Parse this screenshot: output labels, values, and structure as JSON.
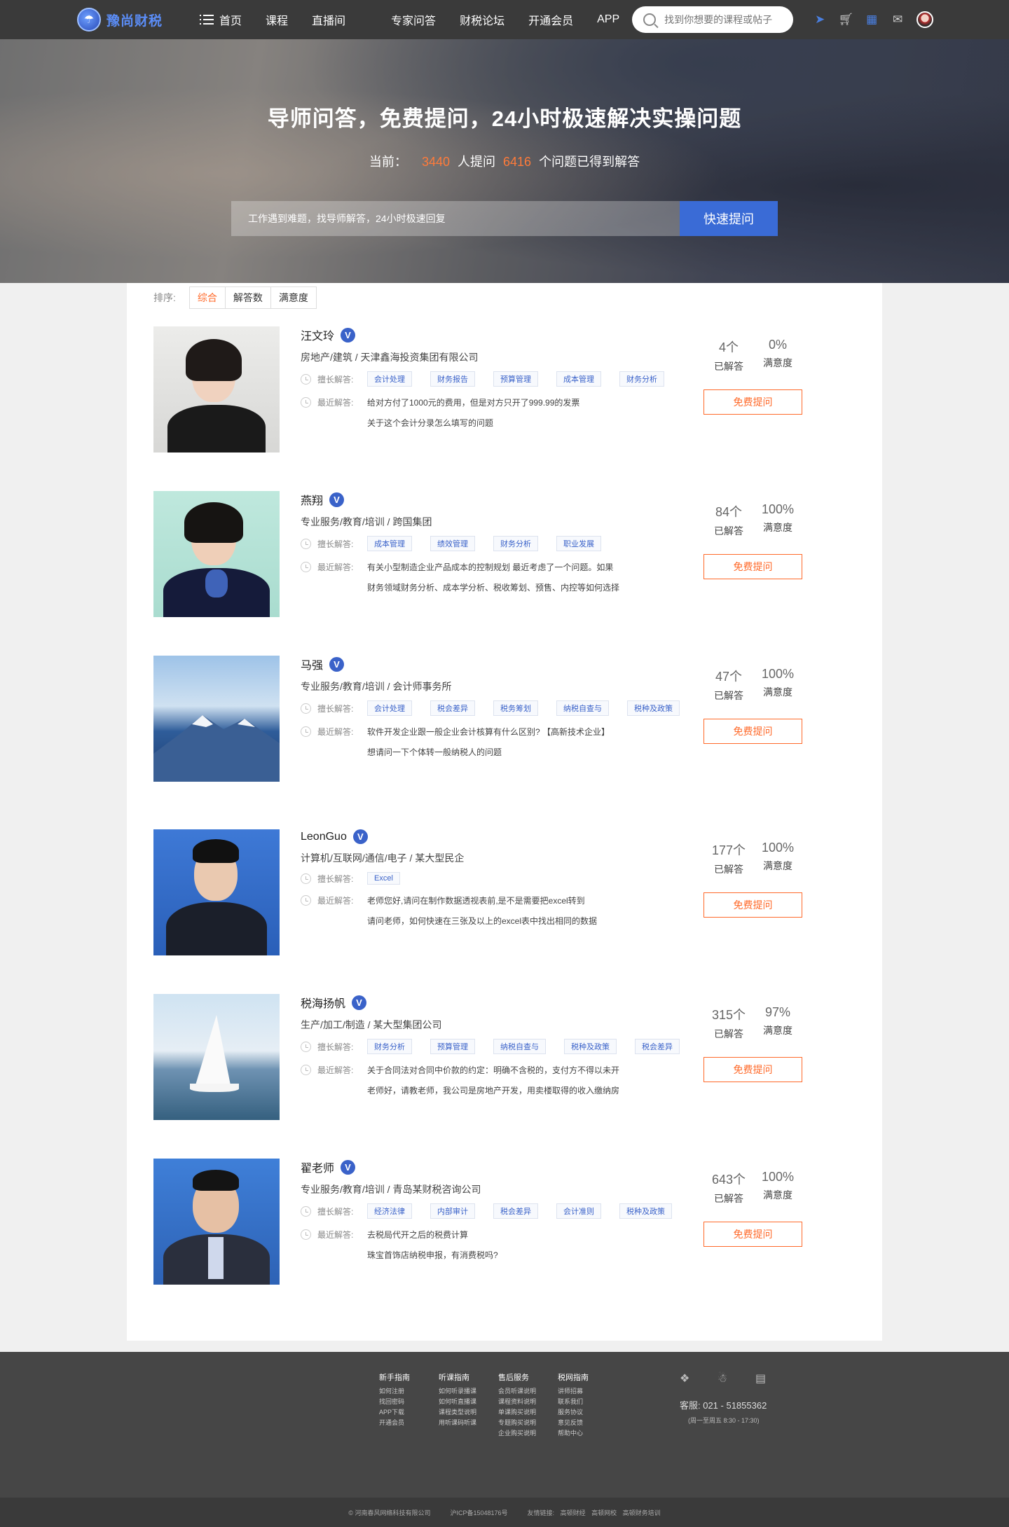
{
  "nav": {
    "logo_text": "豫尚财税",
    "links": [
      "首页",
      "课程",
      "直播间",
      "专家问答",
      "财税论坛",
      "开通会员",
      "APP"
    ],
    "search_placeholder": "找到你想要的课程或帖子",
    "icons": [
      "send-icon",
      "cart-icon",
      "gift-icon",
      "message-icon",
      "user-avatar"
    ]
  },
  "hero": {
    "title": "导师问答，免费提问，24小时极速解决实操问题",
    "stats_prefix": "当前：",
    "askers": "3440",
    "askers_label": "人提问",
    "answered": "6416",
    "answered_label": "个问题已得到解答",
    "input_placeholder": "工作遇到难题，找导师解答，24小时极速回复",
    "ask_button": "快速提问"
  },
  "sort": {
    "label": "排序:",
    "tabs": [
      "综合",
      "解答数",
      "满意度"
    ],
    "active": "综合"
  },
  "labels": {
    "specialty": "擅长解答:",
    "recent": "最近解答:",
    "answered": "已解答",
    "satisfaction": "满意度",
    "ask_free": "免费提问",
    "verified": "V"
  },
  "experts": [
    {
      "name": "汪文玲",
      "industry": "房地产/建筑 / 天津鑫海投资集团有限公司",
      "tags": [
        "会计处理",
        "财务报告",
        "预算管理",
        "成本管理",
        "财务分析"
      ],
      "recent": [
        "给对方付了1000元的费用，但是对方只开了999.99的发票",
        "关于这个会计分录怎么填写的问题"
      ],
      "answered": "4个",
      "satisfaction": "0%"
    },
    {
      "name": "燕翔",
      "industry": "专业服务/教育/培训 / 跨国集团",
      "tags": [
        "成本管理",
        "绩效管理",
        "财务分析",
        "职业发展"
      ],
      "recent": [
        "有关小型制造企业产品成本的控制规划 最近考虑了一个问题。如果",
        "财务领域财务分析、成本学分析、税收筹划、预售、内控等如何选择"
      ],
      "answered": "84个",
      "satisfaction": "100%"
    },
    {
      "name": "马强",
      "industry": "专业服务/教育/培训 / 会计师事务所",
      "tags": [
        "会计处理",
        "税会差异",
        "税务筹划",
        "纳税自查与",
        "税种及政策"
      ],
      "recent": [
        "软件开发企业跟一般企业会计核算有什么区别? 【高新技术企业】",
        "想请问一下个体转一般纳税人的问题"
      ],
      "answered": "47个",
      "satisfaction": "100%"
    },
    {
      "name": "LeonGuo",
      "industry": "计算机/互联网/通信/电子 / 某大型民企",
      "tags": [
        "Excel"
      ],
      "recent": [
        "老师您好,请问在制作数据透视表前,是不是需要把excel转到",
        "请问老师，如何快速在三张及以上的excel表中找出相同的数据"
      ],
      "answered": "177个",
      "satisfaction": "100%"
    },
    {
      "name": "税海扬帆",
      "industry": "生产/加工/制造 / 某大型集团公司",
      "tags": [
        "财务分析",
        "预算管理",
        "纳税自查与",
        "税种及政策",
        "税会差异"
      ],
      "recent": [
        "关于合同法对合同中价款的约定：明确不含税的，支付方不得以未开",
        "老师好，请教老师，我公司是房地产开发，用卖楼取得的收入缴纳房"
      ],
      "answered": "315个",
      "satisfaction": "97%"
    },
    {
      "name": "翟老师",
      "industry": "专业服务/教育/培训 / 青岛某财税咨询公司",
      "tags": [
        "经济法律",
        "内部审计",
        "税会差异",
        "会计准则",
        "税种及政策"
      ],
      "recent": [
        "去税局代开之后的税费计算",
        "珠宝首饰店纳税申报，有消费税吗?"
      ],
      "answered": "643个",
      "satisfaction": "100%"
    }
  ],
  "footer": {
    "columns": [
      {
        "title": "新手指南",
        "items": [
          "如何注册",
          "找回密码",
          "APP下载",
          "开通会员"
        ]
      },
      {
        "title": "听课指南",
        "items": [
          "如何听录播课",
          "如何听直播课",
          "课程类型说明",
          "用听课码听课"
        ]
      },
      {
        "title": "售后服务",
        "items": [
          "会员听课说明",
          "课程资料说明",
          "单课购买说明",
          "专题购买说明",
          "企业购买说明"
        ]
      },
      {
        "title": "税网指南",
        "items": [
          "讲师招募",
          "联系我们",
          "服务协议",
          "意见反馈",
          "帮助中心"
        ]
      }
    ],
    "service": "客服: 021 - 51855362",
    "hours": "(周一至周五 8:30 - 17:30)",
    "copyright": "© 河南春风网络科技有限公司",
    "icp": "沪ICP备15048176号",
    "links_label": "友情链接:",
    "friend_links": [
      "高顿财经",
      "高顿网校",
      "高顿财务培训"
    ]
  }
}
